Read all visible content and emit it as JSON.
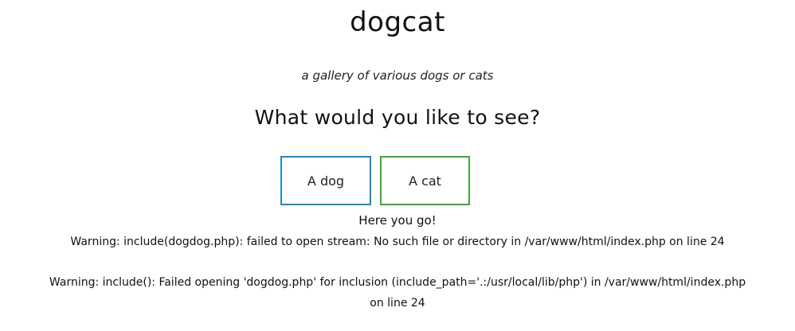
{
  "header": {
    "title": "dogcat",
    "subtitle": "a gallery of various dogs or cats"
  },
  "main": {
    "question": "What would you like to see?",
    "buttons": {
      "dog_label": "A dog",
      "cat_label": "A cat"
    },
    "result_text": "Here you go!"
  },
  "errors": {
    "warning_1": "Warning: include(dogdog.php): failed to open stream: No such file or directory in /var/www/html/index.php on line 24",
    "warning_2": "Warning: include(): Failed opening 'dogdog.php' for inclusion (include_path='.:/usr/local/lib/php') in /var/www/html/index.php",
    "warning_2_cont": "on line 24"
  },
  "colors": {
    "dog_button_border": "#1f87c2",
    "cat_button_border": "#3aa83a",
    "background": "#ffffff",
    "text": "#111111"
  }
}
